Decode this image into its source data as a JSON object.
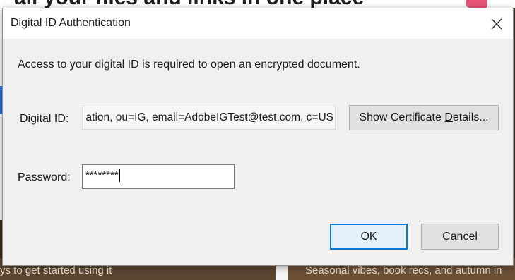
{
  "background": {
    "top_text": "all your files and links in one place",
    "bottom_left_text": "ys to get started using it",
    "bottom_right_text": "Seasonal vibes, book recs, and autumn in"
  },
  "dialog": {
    "title": "Digital ID Authentication",
    "close_icon": "close-icon",
    "message": "Access to your digital ID is required to open an encrypted document.",
    "digital_id_label": "Digital ID:",
    "digital_id_value": "ation, ou=IG, email=AdobeIGTest@test.com, c=US",
    "cert_button_prefix": "Show Certificate ",
    "cert_button_mnemonic": "D",
    "cert_button_suffix": "etails...",
    "password_label": "Password:",
    "password_value": "********",
    "ok_label": "OK",
    "cancel_label": "Cancel"
  },
  "colors": {
    "dialog_bg": "#f0f0f0",
    "default_button_border": "#0078d7"
  }
}
